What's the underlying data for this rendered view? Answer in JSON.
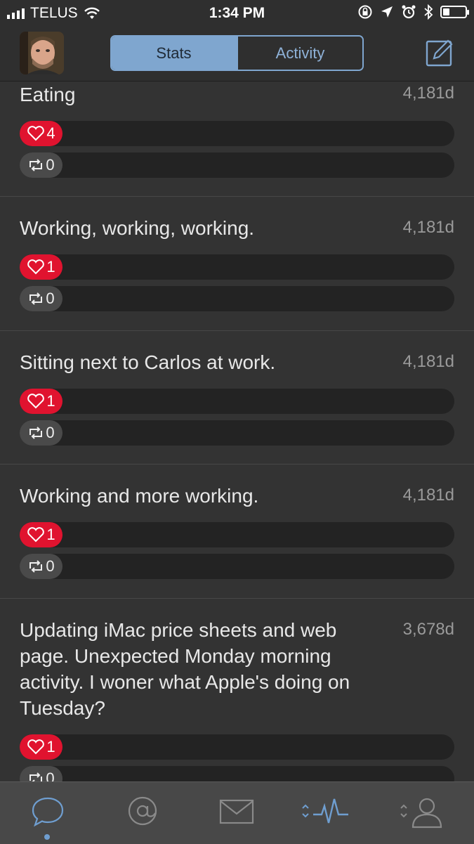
{
  "status": {
    "carrier": "TELUS",
    "time": "1:34 PM",
    "battery_level": 0.3
  },
  "header": {
    "tabs": [
      {
        "label": "Stats"
      },
      {
        "label": "Activity"
      }
    ]
  },
  "posts": [
    {
      "text": "Eating",
      "age": "4,181d",
      "likes": "4",
      "reposts": "0"
    },
    {
      "text": "Working, working, working.",
      "age": "4,181d",
      "likes": "1",
      "reposts": "0"
    },
    {
      "text": "Sitting next to Carlos at work.",
      "age": "4,181d",
      "likes": "1",
      "reposts": "0"
    },
    {
      "text": "Working and more working.",
      "age": "4,181d",
      "likes": "1",
      "reposts": "0"
    },
    {
      "text": "Updating iMac price sheets and web page.  Unexpected Monday morning activity.  I woner what Apple's doing on Tuesday?",
      "age": "3,678d",
      "likes": "1",
      "reposts": "0"
    }
  ],
  "tabbar": {
    "icons": [
      "chat-bubble-icon",
      "mentions-icon",
      "mail-icon",
      "activity-pulse-icon",
      "profile-icon"
    ]
  },
  "colors": {
    "accent": "#7fa6cf",
    "like": "#e0132f",
    "background": "#333333"
  }
}
